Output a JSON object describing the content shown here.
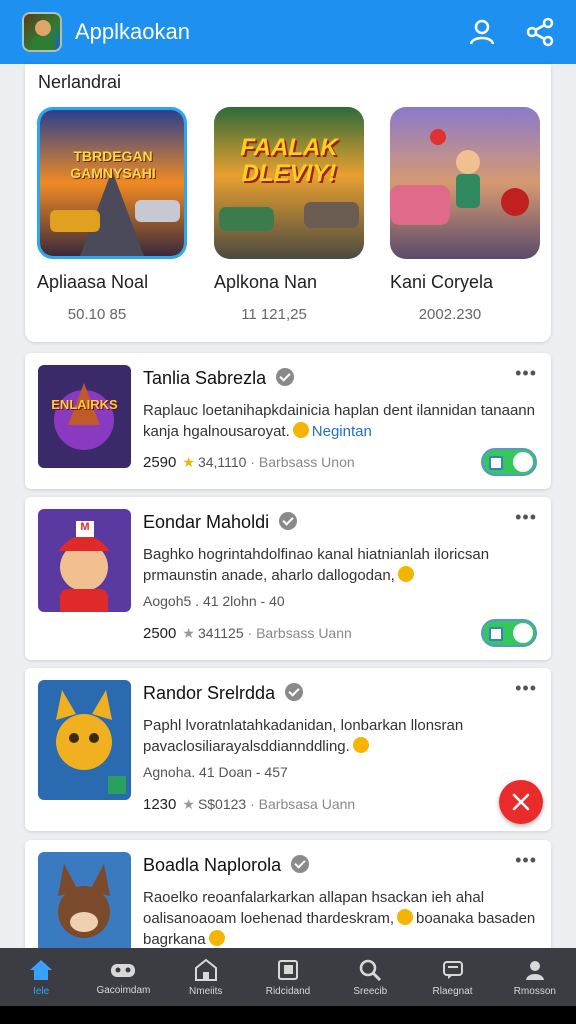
{
  "header": {
    "title": "Applkaokan",
    "profile_icon": "person-icon",
    "share_icon": "share-icon",
    "color": "#1e90f0"
  },
  "featured": {
    "title": "Nerlandrai",
    "items": [
      {
        "name": "Apliaasa Noal",
        "count": "50.10 85",
        "art_text": "TBRDEGAN GAMNYSAHI",
        "selected": true
      },
      {
        "name": "Aplkona Nan",
        "count": "11 121,25",
        "art_text": "FAALAK DLEVIY!"
      },
      {
        "name": "Kani Coryela",
        "count": "2002.230"
      }
    ]
  },
  "apps": [
    {
      "title": "Tanlia Sabrezla",
      "desc_1": "Raplauc loetanihapkdainicia haplan dent ilannidan tanaann kanja hgalnousaroyat.",
      "desc_tag": "Negintan",
      "stats_count": "2590",
      "stats_rating": "34,1110",
      "stats_note": "Barbsass Unon",
      "art_text": "ENLAIRKS"
    },
    {
      "title": "Eondar Maholdi",
      "desc_1": "Baghko hogrintahdolfinao kanal hiatnianlah iloricsan prmaunstin anade, aharlo dallogodan,",
      "meta": "Aogoh5 . 41   2lohn - 40",
      "stats_count": "2500",
      "stats_rating": "341125",
      "stats_note": "Barbsass Uann",
      "art_text": "M"
    },
    {
      "title": "Randor Srelrdda",
      "desc_1": "Paphl lvoratnlatahkadanidan, lonbarkan llonsran pavaclosiliarayalsddiannddling.",
      "meta": "Agnoha. 41   Doan - 457",
      "stats_count": "1230",
      "stats_rating": "S$0123",
      "stats_note": "Barbsasa Uann"
    },
    {
      "title": "Boadla Naplorola",
      "desc_1": "Raoelko reoanfalarkarkan allapan hsackan ieh ahal oalisanoaoam loehenad thardeskram,",
      "desc_2": "boanaka basaden bagrkana"
    }
  ],
  "fab": {
    "icon": "close-icon",
    "color": "#e92b2b"
  },
  "nav": [
    {
      "label": "Iele",
      "icon": "home-icon",
      "active": true
    },
    {
      "label": "Gacoimdam",
      "icon": "gamepad-icon"
    },
    {
      "label": "Nmeiits",
      "icon": "store-icon"
    },
    {
      "label": "Ridcidand",
      "icon": "gallery-icon"
    },
    {
      "label": "Sreecib",
      "icon": "search-icon"
    },
    {
      "label": "Rlaegnat",
      "icon": "chat-icon"
    },
    {
      "label": "Rmosson",
      "icon": "profile-icon"
    }
  ]
}
